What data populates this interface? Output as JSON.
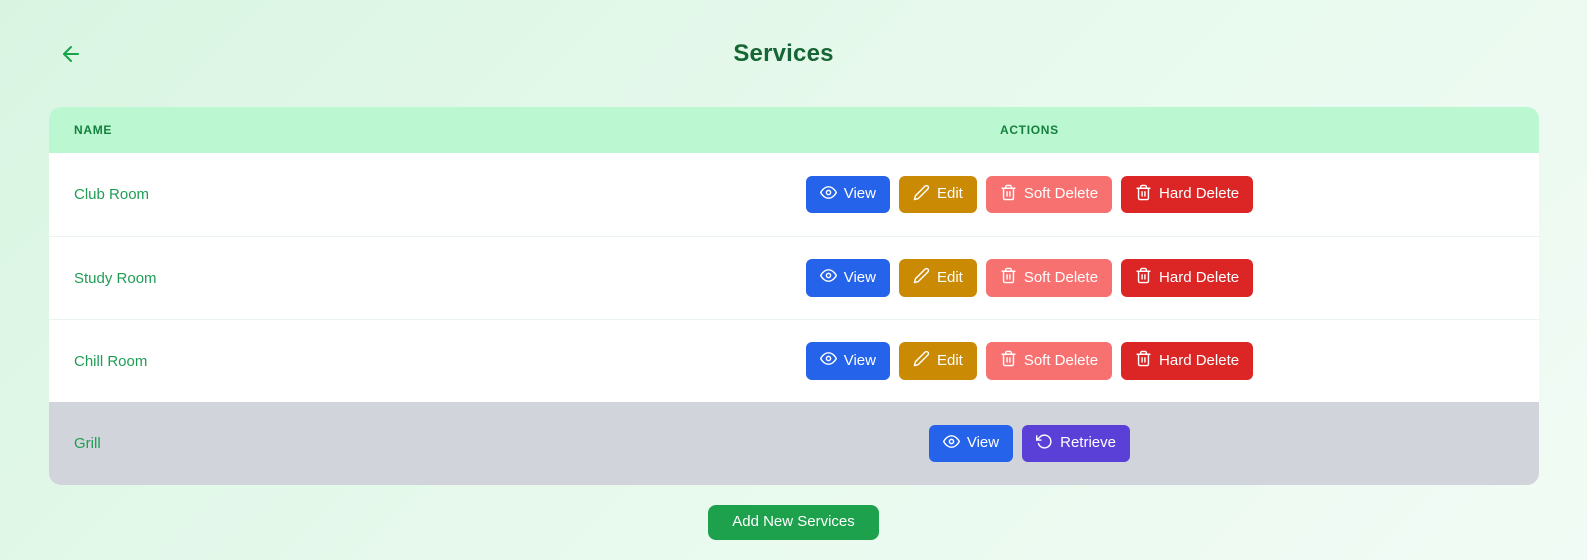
{
  "page": {
    "title": "Services"
  },
  "table": {
    "headers": {
      "name": "NAME",
      "actions": "ACTIONS"
    },
    "rows": [
      {
        "name": "Club Room",
        "state": "active"
      },
      {
        "name": "Study Room",
        "state": "active"
      },
      {
        "name": "Chill Room",
        "state": "active"
      },
      {
        "name": "Grill",
        "state": "soft-deleted"
      }
    ]
  },
  "buttons": {
    "view": "View",
    "edit": "Edit",
    "soft_delete": "Soft Delete",
    "hard_delete": "Hard Delete",
    "retrieve": "Retrieve",
    "add_new": "Add New Services"
  },
  "icons": {
    "back": "arrow-left-icon",
    "view": "eye-icon",
    "edit": "pencil-icon",
    "soft_delete": "trash-icon",
    "hard_delete": "trash-icon",
    "retrieve": "rotate-ccw-icon"
  },
  "colors": {
    "background_mint": "#e3f8ea",
    "title_green": "#166534",
    "header_bg_green": "#bbf7d0",
    "header_text_green": "#15803d",
    "row_name_green": "#1f9d55",
    "view_blue": "#2563eb",
    "edit_gold": "#ca8a04",
    "soft_delete_salmon": "#f87171",
    "hard_delete_red": "#dc2626",
    "retrieve_purple": "#5b40d8",
    "deleted_row_gray": "#d1d5db",
    "add_button_green": "#1ea14d"
  }
}
